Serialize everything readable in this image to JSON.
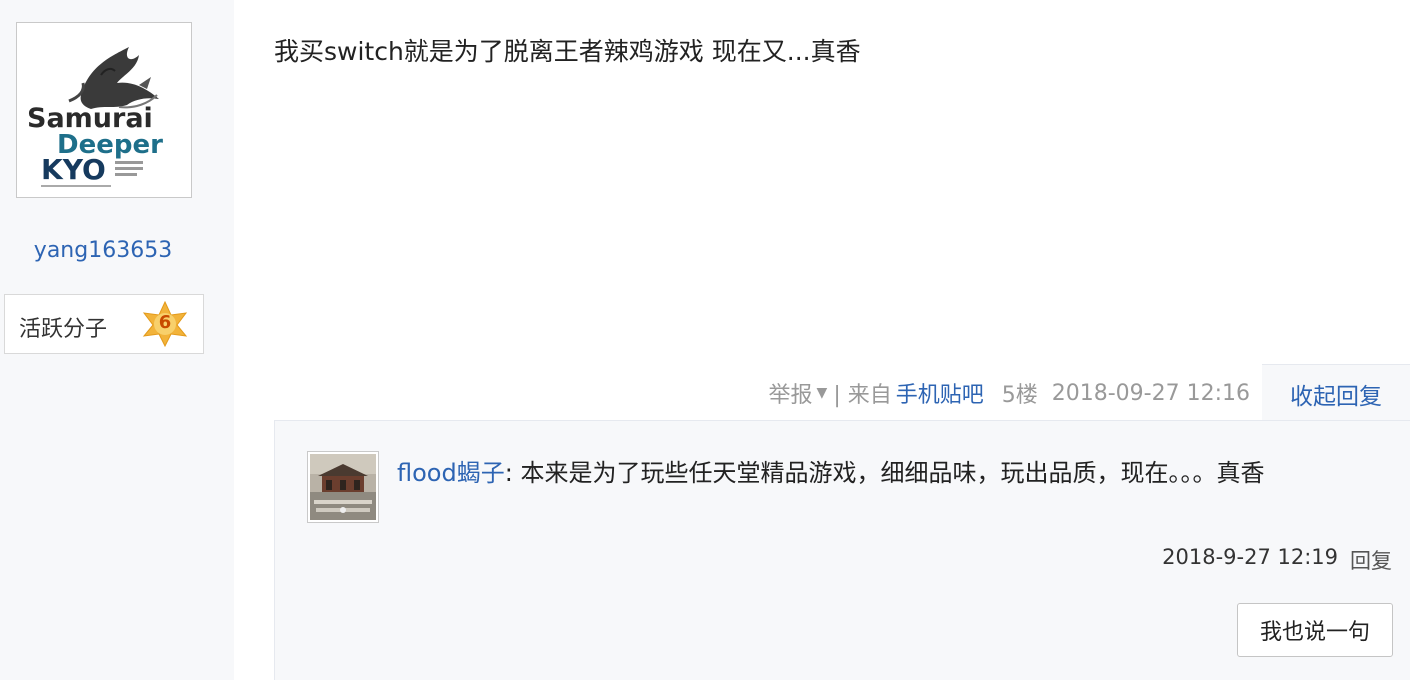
{
  "author": {
    "avatar_logo_lines": [
      "Samurai",
      "Deeper",
      "KYO"
    ],
    "username": "yang163653",
    "level_name": "活跃分子",
    "level_number": "6"
  },
  "post": {
    "content": "我买switch就是为了脱离王者辣鸡游戏 现在又...真香",
    "tail": {
      "report": "举报",
      "from_prefix": "| 来自",
      "client": "手机贴吧",
      "floor": "5楼",
      "datetime": "2018-09-27 12:16"
    },
    "collapse_label": "收起回复"
  },
  "replies": [
    {
      "username": "flood蝎子",
      "separator": ":",
      "content": "本来是为了玩些任天堂精品游戏，细细品味，玩出品质，现在。。。真香",
      "datetime": "2018-9-27 12:19",
      "reply_label": "回复"
    }
  ],
  "reply_box": {
    "say_button": "我也说一句"
  },
  "colors": {
    "link": "#2d64b3",
    "panel_bg": "#f7f8fa",
    "muted": "#999999"
  }
}
